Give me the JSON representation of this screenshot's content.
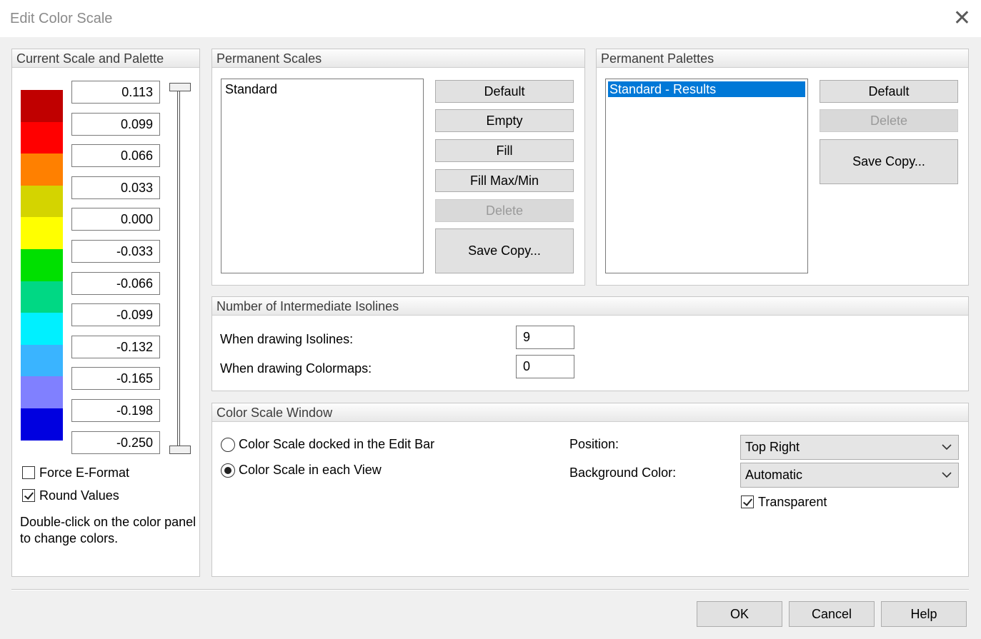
{
  "window": {
    "title": "Edit Color Scale"
  },
  "current_scale": {
    "header": "Current Scale and Palette",
    "colors": [
      "#c00000",
      "#ff0000",
      "#ff8000",
      "#d4d400",
      "#ffff00",
      "#00e000",
      "#00d884",
      "#00f0ff",
      "#3ab4ff",
      "#8080ff",
      "#0000e0"
    ],
    "values": [
      "0.113",
      "0.099",
      "0.066",
      "0.033",
      "0.000",
      "-0.033",
      "-0.066",
      "-0.099",
      "-0.132",
      "-0.165",
      "-0.198",
      "-0.250"
    ],
    "force_eformat": {
      "label": "Force E-Format",
      "checked": false
    },
    "round_values": {
      "label": "Round Values",
      "checked": true
    },
    "hint": "Double-click on the color panel to change colors."
  },
  "permanent_scales": {
    "header": "Permanent Scales",
    "items": [
      "Standard"
    ],
    "buttons": {
      "default": "Default",
      "empty": "Empty",
      "fill": "Fill",
      "fill_maxmin": "Fill Max/Min",
      "delete": "Delete",
      "save_copy": "Save Copy..."
    }
  },
  "permanent_palettes": {
    "header": "Permanent Palettes",
    "items": [
      "Standard - Results"
    ],
    "buttons": {
      "default": "Default",
      "delete": "Delete",
      "save_copy": "Save Copy..."
    }
  },
  "isolines": {
    "header": "Number of Intermediate Isolines",
    "isolines_label": "When drawing Isolines:",
    "isolines_value": "9",
    "colormaps_label": "When drawing Colormaps:",
    "colormaps_value": "0"
  },
  "color_scale_window": {
    "header": "Color Scale Window",
    "radio_docked": {
      "label": "Color Scale docked in the Edit Bar",
      "checked": false
    },
    "radio_each_view": {
      "label": "Color Scale in each View",
      "checked": true
    },
    "position_label": "Position:",
    "position_value": "Top Right",
    "background_label": "Background Color:",
    "background_value": "Automatic",
    "transparent": {
      "label": "Transparent",
      "checked": true
    }
  },
  "footer": {
    "ok": "OK",
    "cancel": "Cancel",
    "help": "Help"
  }
}
